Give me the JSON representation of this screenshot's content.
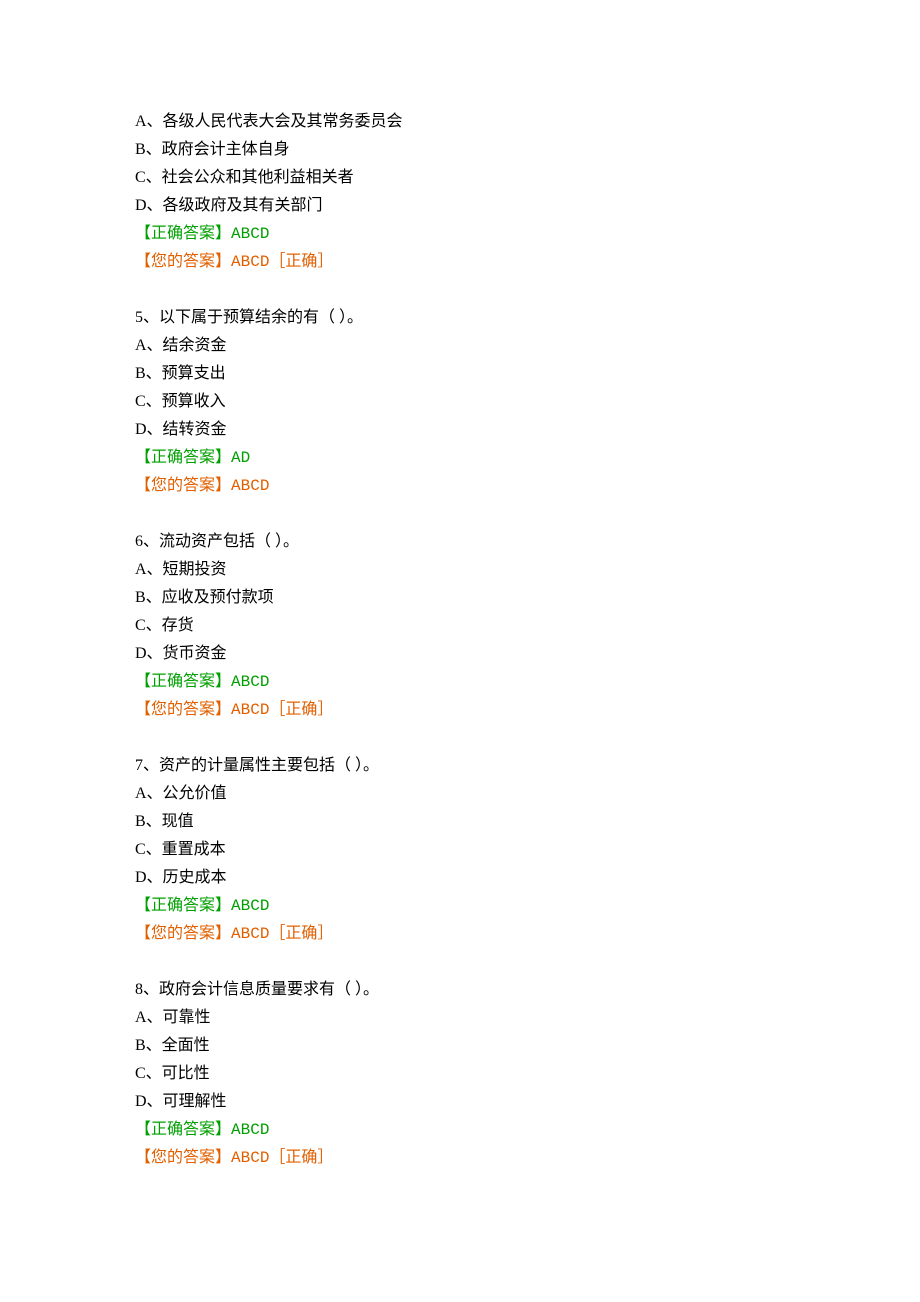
{
  "labels": {
    "correct_answer": "【正确答案】",
    "your_answer": "【您的答案】",
    "correct_suffix": "［正确］"
  },
  "questions": [
    {
      "options": [
        "A、各级人民代表大会及其常务委员会",
        "B、政府会计主体自身",
        "C、社会公众和其他利益相关者",
        "D、各级政府及其有关部门"
      ],
      "correct": "ABCD",
      "your": "ABCD",
      "is_correct": true,
      "show_stem": false
    },
    {
      "stem": "5、以下属于预算结余的有（ ）。",
      "options": [
        "A、结余资金",
        "B、预算支出",
        "C、预算收入",
        "D、结转资金"
      ],
      "correct": "AD",
      "your": "ABCD",
      "is_correct": false,
      "show_stem": true
    },
    {
      "stem": "6、流动资产包括（ ）。",
      "options": [
        "A、短期投资",
        "B、应收及预付款项",
        "C、存货",
        "D、货币资金"
      ],
      "correct": "ABCD",
      "your": "ABCD",
      "is_correct": true,
      "show_stem": true
    },
    {
      "stem": "7、资产的计量属性主要包括（ ）。",
      "options": [
        "A、公允价值",
        "B、现值",
        "C、重置成本",
        "D、历史成本"
      ],
      "correct": "ABCD",
      "your": "ABCD",
      "is_correct": true,
      "show_stem": true
    },
    {
      "stem": "8、政府会计信息质量要求有（ ）。",
      "options": [
        "A、可靠性",
        "B、全面性",
        "C、可比性",
        "D、可理解性"
      ],
      "correct": "ABCD",
      "your": "ABCD",
      "is_correct": true,
      "show_stem": true
    }
  ]
}
